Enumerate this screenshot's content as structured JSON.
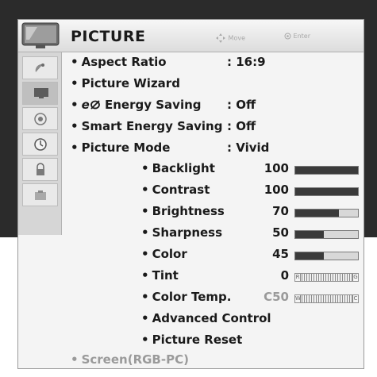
{
  "menu": {
    "title": "PICTURE",
    "hint_move": "Move",
    "hint_enter": "Enter"
  },
  "items": [
    {
      "bullet": "•",
      "label": "Aspect Ratio",
      "value": ": 16:9"
    },
    {
      "bullet": "•",
      "label": "Picture Wizard"
    },
    {
      "bullet": "•",
      "label_prefix": "e",
      "label": " Energy Saving",
      "value": ": Off"
    },
    {
      "bullet": "•",
      "label": "Smart Energy Saving",
      "value": ": Off"
    },
    {
      "bullet": "•",
      "label": "Picture Mode",
      "value": ": Vivid"
    }
  ],
  "settings": [
    {
      "bullet": "•",
      "label": "Backlight",
      "value": "100",
      "level": 1.0
    },
    {
      "bullet": "•",
      "label": "Contrast",
      "value": "100",
      "level": 1.0
    },
    {
      "bullet": "•",
      "label": "Brightness",
      "value": "70",
      "level": 0.7
    },
    {
      "bullet": "•",
      "label": "Sharpness",
      "value": "50",
      "level": 0.45
    },
    {
      "bullet": "•",
      "label": "Color",
      "value": "45",
      "level": 0.45
    },
    {
      "bullet": "•",
      "label": "Tint",
      "value": "0",
      "scale": "R-G"
    },
    {
      "bullet": "•",
      "label": "Color Temp.",
      "value": "C50",
      "scale": "W-C"
    },
    {
      "bullet": "•",
      "label": "Advanced Control"
    },
    {
      "bullet": "•",
      "label": "Picture Reset"
    }
  ],
  "extra": {
    "bullet": "•",
    "label": "Screen(RGB-PC)"
  },
  "sidebar_icons": [
    "satellite-dish-icon",
    "tv-icon",
    "audio-icon",
    "clock-icon",
    "lock-icon",
    "option-icon"
  ],
  "colors": {
    "bar_fill": "#3a3a3a",
    "panel": "#f4f4f4",
    "muted": "#9a9a9a"
  }
}
